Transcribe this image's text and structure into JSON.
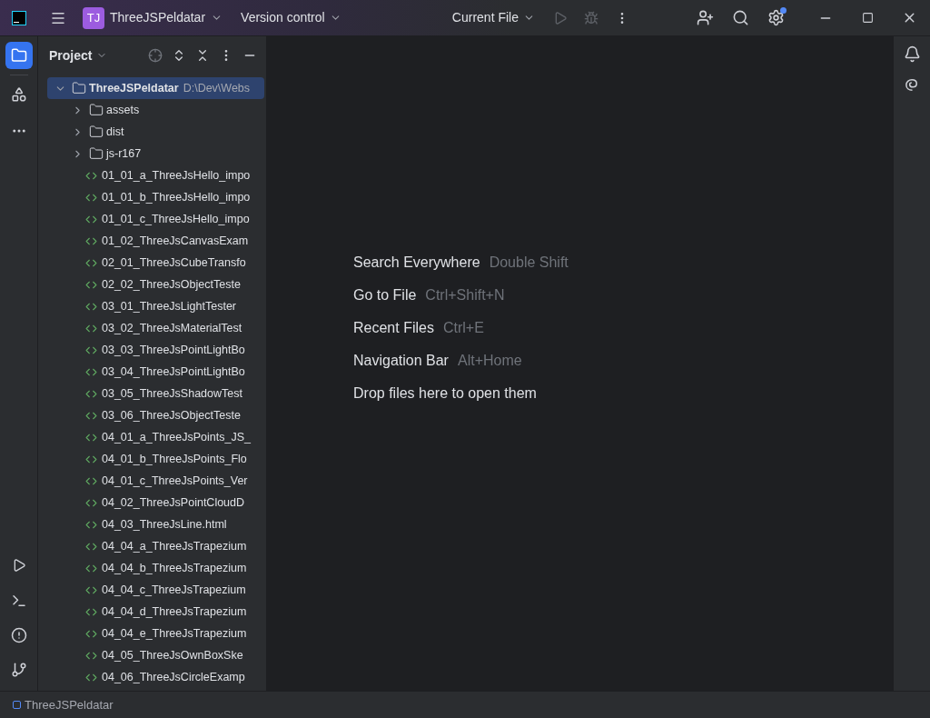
{
  "title_bar": {
    "project_badge": "TJ",
    "project_name": "ThreeJSPeldatar",
    "vcs_menu": "Version control",
    "run_config": "Current File",
    "settings_badge": true
  },
  "project_panel": {
    "title": "Project",
    "tree": [
      {
        "kind": "folder",
        "name": "ThreeJSPeldatar",
        "path": "D:\\Dev\\Webs",
        "expanded": true,
        "selected": true,
        "children": [
          {
            "kind": "folder",
            "name": "assets",
            "expanded": false,
            "selected": false
          },
          {
            "kind": "folder",
            "name": "dist",
            "expanded": false,
            "selected": false
          },
          {
            "kind": "folder",
            "name": "js-r167",
            "expanded": false,
            "selected": false
          },
          {
            "kind": "file",
            "name": "01_01_a_ThreeJsHello_impo",
            "selected": false
          },
          {
            "kind": "file",
            "name": "01_01_b_ThreeJsHello_impo",
            "selected": false
          },
          {
            "kind": "file",
            "name": "01_01_c_ThreeJsHello_impo",
            "selected": false
          },
          {
            "kind": "file",
            "name": "01_02_ThreeJsCanvasExam",
            "selected": false
          },
          {
            "kind": "file",
            "name": "02_01_ThreeJsCubeTransfo",
            "selected": false
          },
          {
            "kind": "file",
            "name": "02_02_ThreeJsObjectTeste",
            "selected": false
          },
          {
            "kind": "file",
            "name": "03_01_ThreeJsLightTester",
            "selected": false
          },
          {
            "kind": "file",
            "name": "03_02_ThreeJsMaterialTest",
            "selected": false
          },
          {
            "kind": "file",
            "name": "03_03_ThreeJsPointLightBo",
            "selected": false
          },
          {
            "kind": "file",
            "name": "03_04_ThreeJsPointLightBo",
            "selected": false
          },
          {
            "kind": "file",
            "name": "03_05_ThreeJsShadowTest",
            "selected": false
          },
          {
            "kind": "file",
            "name": "03_06_ThreeJsObjectTeste",
            "selected": false
          },
          {
            "kind": "file",
            "name": "04_01_a_ThreeJsPoints_JS_",
            "selected": false
          },
          {
            "kind": "file",
            "name": "04_01_b_ThreeJsPoints_Flo",
            "selected": false
          },
          {
            "kind": "file",
            "name": "04_01_c_ThreeJsPoints_Ver",
            "selected": false
          },
          {
            "kind": "file",
            "name": "04_02_ThreeJsPointCloudD",
            "selected": false
          },
          {
            "kind": "file",
            "name": "04_03_ThreeJsLine.html",
            "selected": false
          },
          {
            "kind": "file",
            "name": "04_04_a_ThreeJsTrapezium",
            "selected": false
          },
          {
            "kind": "file",
            "name": "04_04_b_ThreeJsTrapezium",
            "selected": false
          },
          {
            "kind": "file",
            "name": "04_04_c_ThreeJsTrapezium",
            "selected": false
          },
          {
            "kind": "file",
            "name": "04_04_d_ThreeJsTrapezium",
            "selected": false
          },
          {
            "kind": "file",
            "name": "04_04_e_ThreeJsTrapezium",
            "selected": false
          },
          {
            "kind": "file",
            "name": "04_05_ThreeJsOwnBoxSke",
            "selected": false
          },
          {
            "kind": "file",
            "name": "04_06_ThreeJsCircleExamp",
            "selected": false
          }
        ]
      }
    ]
  },
  "editor_hints": [
    {
      "label": "Search Everywhere",
      "shortcut": "Double Shift"
    },
    {
      "label": "Go to File",
      "shortcut": "Ctrl+Shift+N"
    },
    {
      "label": "Recent Files",
      "shortcut": "Ctrl+E"
    },
    {
      "label": "Navigation Bar",
      "shortcut": "Alt+Home"
    },
    {
      "label": "Drop files here to open them"
    }
  ],
  "status_bar": {
    "breadcrumb": "ThreeJSPeldatar"
  }
}
